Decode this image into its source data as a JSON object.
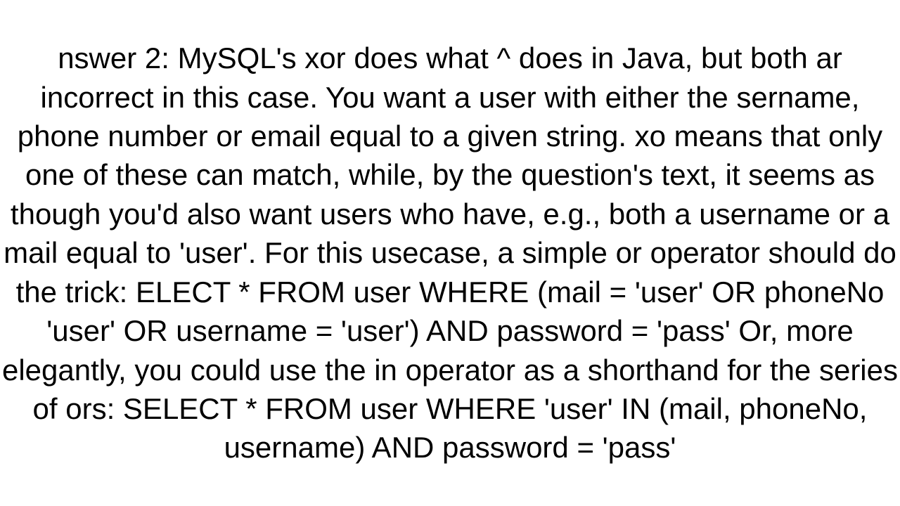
{
  "answer": {
    "label_prefix": "nswer 2: ",
    "paragraph": "MySQL's xor does what ^ does in Java, but both ar incorrect in this case. You want a user with either the sername, phone number or email equal to a given string. xo means that only one of these can match, while, by the question's text, it seems as though you'd also want users who have, e.g., both a username or a mail equal to 'user'. For this usecase, a simple or operator should do the trick: ELECT *  FROM   user  WHERE  (mail = 'user' OR phoneNo 'user' OR username = 'user') AND        password = 'pass'  Or, more elegantly, you could use the in operator as a shorthand for the series of ors: SELECT *  FROM   user  WHERE  'user' IN (mail, phoneNo, username) AND        password = 'pass'"
  }
}
